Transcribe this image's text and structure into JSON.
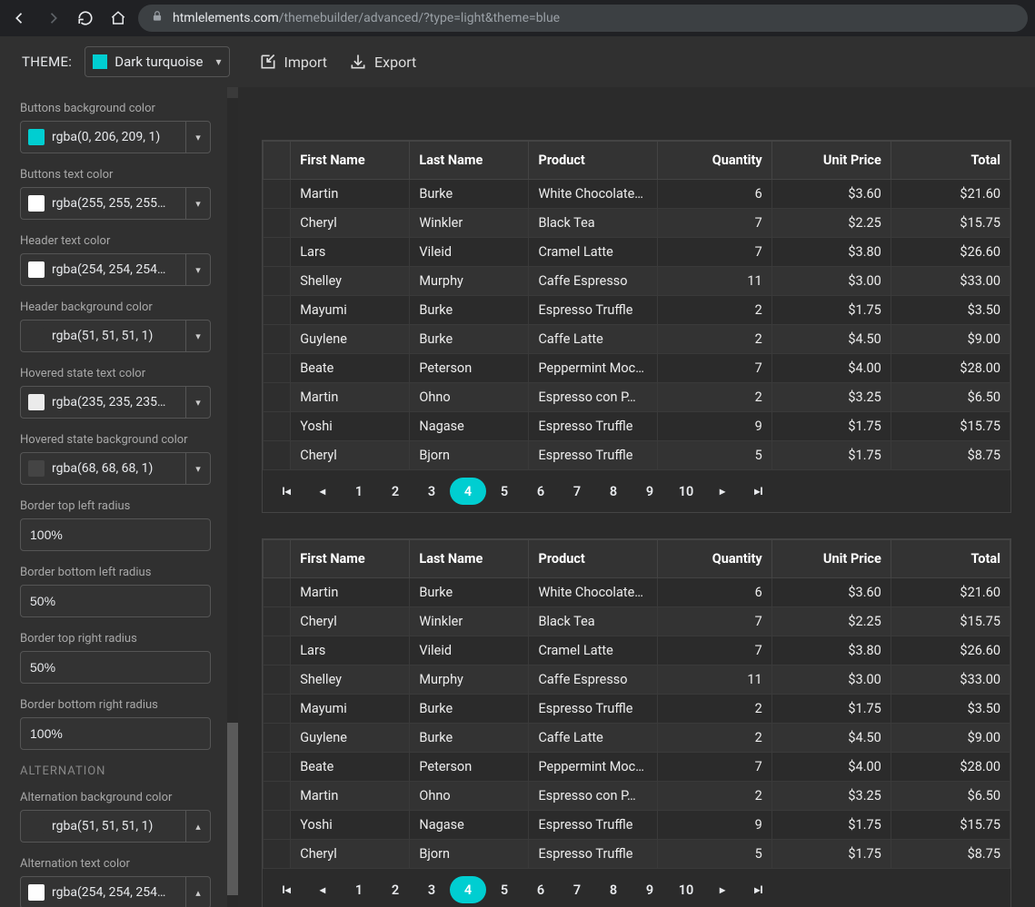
{
  "browser": {
    "host": "htmlelements.com",
    "path": "/themebuilder/advanced/?type=light&theme=blue"
  },
  "header": {
    "theme_label": "THEME:",
    "theme_name": "Dark turquoise",
    "import": "Import",
    "export": "Export"
  },
  "sidebar": {
    "controls": [
      {
        "type": "color",
        "label": "Buttons background color",
        "value": "rgba(0, 206, 209, 1)",
        "swatch": "#00ced1",
        "dir": "down"
      },
      {
        "type": "color",
        "label": "Buttons text color",
        "value": "rgba(255, 255, 255…",
        "swatch": "#ffffff",
        "dir": "down"
      },
      {
        "type": "color",
        "label": "Header text color",
        "value": "rgba(254, 254, 254…",
        "swatch": "#fefefe",
        "dir": "down"
      },
      {
        "type": "color",
        "label": "Header background color",
        "value": "rgba(51, 51, 51, 1)",
        "swatch": "#333333",
        "dir": "down"
      },
      {
        "type": "color",
        "label": "Hovered state text color",
        "value": "rgba(235, 235, 235…",
        "swatch": "#ebebeb",
        "dir": "down"
      },
      {
        "type": "color",
        "label": "Hovered state background color",
        "value": "rgba(68, 68, 68, 1)",
        "swatch": "#444444",
        "dir": "down"
      },
      {
        "type": "text",
        "label": "Border top left radius",
        "value": "100%"
      },
      {
        "type": "text",
        "label": "Border bottom left radius",
        "value": "50%"
      },
      {
        "type": "text",
        "label": "Border top right radius",
        "value": "50%"
      },
      {
        "type": "text",
        "label": "Border bottom right radius",
        "value": "100%"
      },
      {
        "type": "section",
        "label": "ALTERNATION"
      },
      {
        "type": "color",
        "label": "Alternation background color",
        "value": "rgba(51, 51, 51, 1)",
        "swatch": "#333333",
        "dir": "up"
      },
      {
        "type": "color",
        "label": "Alternation text color",
        "value": "rgba(254, 254, 254…",
        "swatch": "#fefefe",
        "dir": "up"
      }
    ]
  },
  "table": {
    "headers": [
      "First Name",
      "Last Name",
      "Product",
      "Quantity",
      "Unit Price",
      "Total"
    ],
    "rows": [
      [
        "Martin",
        "Burke",
        "White Chocolate…",
        "6",
        "$3.60",
        "$21.60"
      ],
      [
        "Cheryl",
        "Winkler",
        "Black Tea",
        "7",
        "$2.25",
        "$15.75"
      ],
      [
        "Lars",
        "Vileid",
        "Cramel Latte",
        "7",
        "$3.80",
        "$26.60"
      ],
      [
        "Shelley",
        "Murphy",
        "Caffe Espresso",
        "11",
        "$3.00",
        "$33.00"
      ],
      [
        "Mayumi",
        "Burke",
        "Espresso Truffle",
        "2",
        "$1.75",
        "$3.50"
      ],
      [
        "Guylene",
        "Burke",
        "Caffe Latte",
        "2",
        "$4.50",
        "$9.00"
      ],
      [
        "Beate",
        "Peterson",
        "Peppermint Moc…",
        "7",
        "$4.00",
        "$28.00"
      ],
      [
        "Martin",
        "Ohno",
        "Espresso con P…",
        "2",
        "$3.25",
        "$6.50"
      ],
      [
        "Yoshi",
        "Nagase",
        "Espresso Truffle",
        "9",
        "$1.75",
        "$15.75"
      ],
      [
        "Cheryl",
        "Bjorn",
        "Espresso Truffle",
        "5",
        "$1.75",
        "$8.75"
      ]
    ],
    "pager": [
      "1",
      "2",
      "3",
      "4",
      "5",
      "6",
      "7",
      "8",
      "9",
      "10"
    ],
    "active_page": "4"
  },
  "colors": {
    "accent": "#00ced1"
  }
}
